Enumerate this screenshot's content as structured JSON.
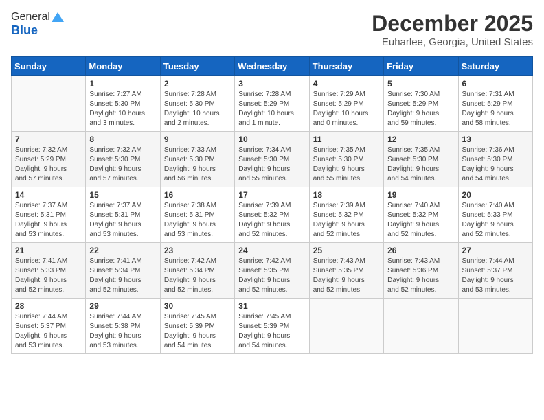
{
  "header": {
    "logo_general": "General",
    "logo_blue": "Blue",
    "month_title": "December 2025",
    "location": "Euharlee, Georgia, United States"
  },
  "calendar": {
    "days_of_week": [
      "Sunday",
      "Monday",
      "Tuesday",
      "Wednesday",
      "Thursday",
      "Friday",
      "Saturday"
    ],
    "weeks": [
      [
        {
          "day": "",
          "info": ""
        },
        {
          "day": "1",
          "info": "Sunrise: 7:27 AM\nSunset: 5:30 PM\nDaylight: 10 hours\nand 3 minutes."
        },
        {
          "day": "2",
          "info": "Sunrise: 7:28 AM\nSunset: 5:30 PM\nDaylight: 10 hours\nand 2 minutes."
        },
        {
          "day": "3",
          "info": "Sunrise: 7:28 AM\nSunset: 5:29 PM\nDaylight: 10 hours\nand 1 minute."
        },
        {
          "day": "4",
          "info": "Sunrise: 7:29 AM\nSunset: 5:29 PM\nDaylight: 10 hours\nand 0 minutes."
        },
        {
          "day": "5",
          "info": "Sunrise: 7:30 AM\nSunset: 5:29 PM\nDaylight: 9 hours\nand 59 minutes."
        },
        {
          "day": "6",
          "info": "Sunrise: 7:31 AM\nSunset: 5:29 PM\nDaylight: 9 hours\nand 58 minutes."
        }
      ],
      [
        {
          "day": "7",
          "info": "Sunrise: 7:32 AM\nSunset: 5:29 PM\nDaylight: 9 hours\nand 57 minutes."
        },
        {
          "day": "8",
          "info": "Sunrise: 7:32 AM\nSunset: 5:30 PM\nDaylight: 9 hours\nand 57 minutes."
        },
        {
          "day": "9",
          "info": "Sunrise: 7:33 AM\nSunset: 5:30 PM\nDaylight: 9 hours\nand 56 minutes."
        },
        {
          "day": "10",
          "info": "Sunrise: 7:34 AM\nSunset: 5:30 PM\nDaylight: 9 hours\nand 55 minutes."
        },
        {
          "day": "11",
          "info": "Sunrise: 7:35 AM\nSunset: 5:30 PM\nDaylight: 9 hours\nand 55 minutes."
        },
        {
          "day": "12",
          "info": "Sunrise: 7:35 AM\nSunset: 5:30 PM\nDaylight: 9 hours\nand 54 minutes."
        },
        {
          "day": "13",
          "info": "Sunrise: 7:36 AM\nSunset: 5:30 PM\nDaylight: 9 hours\nand 54 minutes."
        }
      ],
      [
        {
          "day": "14",
          "info": "Sunrise: 7:37 AM\nSunset: 5:31 PM\nDaylight: 9 hours\nand 53 minutes."
        },
        {
          "day": "15",
          "info": "Sunrise: 7:37 AM\nSunset: 5:31 PM\nDaylight: 9 hours\nand 53 minutes."
        },
        {
          "day": "16",
          "info": "Sunrise: 7:38 AM\nSunset: 5:31 PM\nDaylight: 9 hours\nand 53 minutes."
        },
        {
          "day": "17",
          "info": "Sunrise: 7:39 AM\nSunset: 5:32 PM\nDaylight: 9 hours\nand 52 minutes."
        },
        {
          "day": "18",
          "info": "Sunrise: 7:39 AM\nSunset: 5:32 PM\nDaylight: 9 hours\nand 52 minutes."
        },
        {
          "day": "19",
          "info": "Sunrise: 7:40 AM\nSunset: 5:32 PM\nDaylight: 9 hours\nand 52 minutes."
        },
        {
          "day": "20",
          "info": "Sunrise: 7:40 AM\nSunset: 5:33 PM\nDaylight: 9 hours\nand 52 minutes."
        }
      ],
      [
        {
          "day": "21",
          "info": "Sunrise: 7:41 AM\nSunset: 5:33 PM\nDaylight: 9 hours\nand 52 minutes."
        },
        {
          "day": "22",
          "info": "Sunrise: 7:41 AM\nSunset: 5:34 PM\nDaylight: 9 hours\nand 52 minutes."
        },
        {
          "day": "23",
          "info": "Sunrise: 7:42 AM\nSunset: 5:34 PM\nDaylight: 9 hours\nand 52 minutes."
        },
        {
          "day": "24",
          "info": "Sunrise: 7:42 AM\nSunset: 5:35 PM\nDaylight: 9 hours\nand 52 minutes."
        },
        {
          "day": "25",
          "info": "Sunrise: 7:43 AM\nSunset: 5:35 PM\nDaylight: 9 hours\nand 52 minutes."
        },
        {
          "day": "26",
          "info": "Sunrise: 7:43 AM\nSunset: 5:36 PM\nDaylight: 9 hours\nand 52 minutes."
        },
        {
          "day": "27",
          "info": "Sunrise: 7:44 AM\nSunset: 5:37 PM\nDaylight: 9 hours\nand 53 minutes."
        }
      ],
      [
        {
          "day": "28",
          "info": "Sunrise: 7:44 AM\nSunset: 5:37 PM\nDaylight: 9 hours\nand 53 minutes."
        },
        {
          "day": "29",
          "info": "Sunrise: 7:44 AM\nSunset: 5:38 PM\nDaylight: 9 hours\nand 53 minutes."
        },
        {
          "day": "30",
          "info": "Sunrise: 7:45 AM\nSunset: 5:39 PM\nDaylight: 9 hours\nand 54 minutes."
        },
        {
          "day": "31",
          "info": "Sunrise: 7:45 AM\nSunset: 5:39 PM\nDaylight: 9 hours\nand 54 minutes."
        },
        {
          "day": "",
          "info": ""
        },
        {
          "day": "",
          "info": ""
        },
        {
          "day": "",
          "info": ""
        }
      ]
    ]
  }
}
